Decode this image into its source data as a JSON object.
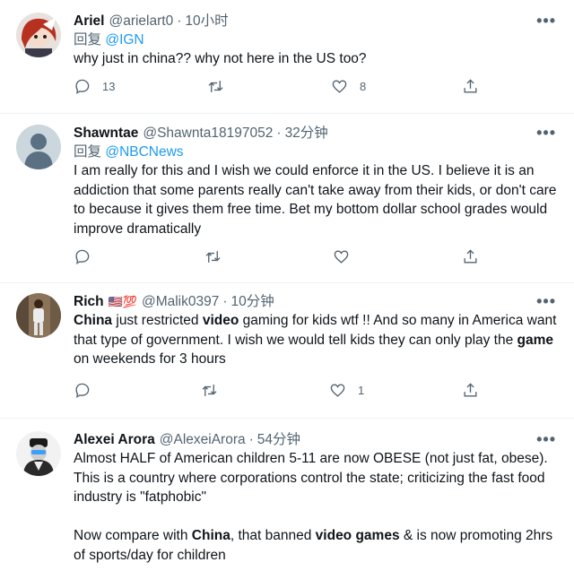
{
  "tweets": [
    {
      "name": "Ariel",
      "handle": "@arielart0",
      "time": "10小时",
      "reply_prefix": "回复",
      "reply_to": "@IGN",
      "body_parts": [
        "why just in china?? why not here in the US too?"
      ],
      "replies": "13",
      "retweets": "",
      "likes": "8"
    },
    {
      "name": "Shawntae",
      "handle": "@Shawnta18197052",
      "time": "32分钟",
      "reply_prefix": "回复",
      "reply_to": "@NBCNews",
      "body_parts": [
        "I am really for this and I wish we could enforce it in the US. I believe it is an addiction that some parents really can't take away from their kids, or don't care to because it gives them free time. Bet my bottom dollar school grades would improve dramatically"
      ],
      "replies": "",
      "retweets": "",
      "likes": ""
    },
    {
      "name": "Rich",
      "emoji": "🇺🇸💯",
      "handle": "@Malik0397",
      "time": "10分钟",
      "body_parts": [
        "China",
        " just restricted ",
        "video",
        " gaming for kids wtf !! And so many in America want that type of government. I wish we would tell kids they can only play the ",
        "game",
        " on weekends for 3 hours"
      ],
      "replies": "",
      "retweets": "",
      "likes": "1"
    },
    {
      "name": "Alexei Arora",
      "handle": "@AlexeiArora",
      "time": "54分钟",
      "body_parts": [
        "Almost HALF of American children 5-11 are now OBESE (not just fat, obese). This is a country where corporations control the state; criticizing the fast food industry is \"fatphobic\"",
        "Now compare with ",
        "China",
        ", that banned ",
        "video games",
        " & is now promoting 2hrs of sports/day for children"
      ]
    }
  ],
  "separator": "·",
  "more_glyph": "•••",
  "icons": [
    "reply-icon",
    "retweet-icon",
    "like-icon",
    "share-icon",
    "more-icon"
  ],
  "colors": {
    "link": "#1d9bf0",
    "secondary": "#536471",
    "text": "#0f1419",
    "divider": "#eff3f4"
  }
}
